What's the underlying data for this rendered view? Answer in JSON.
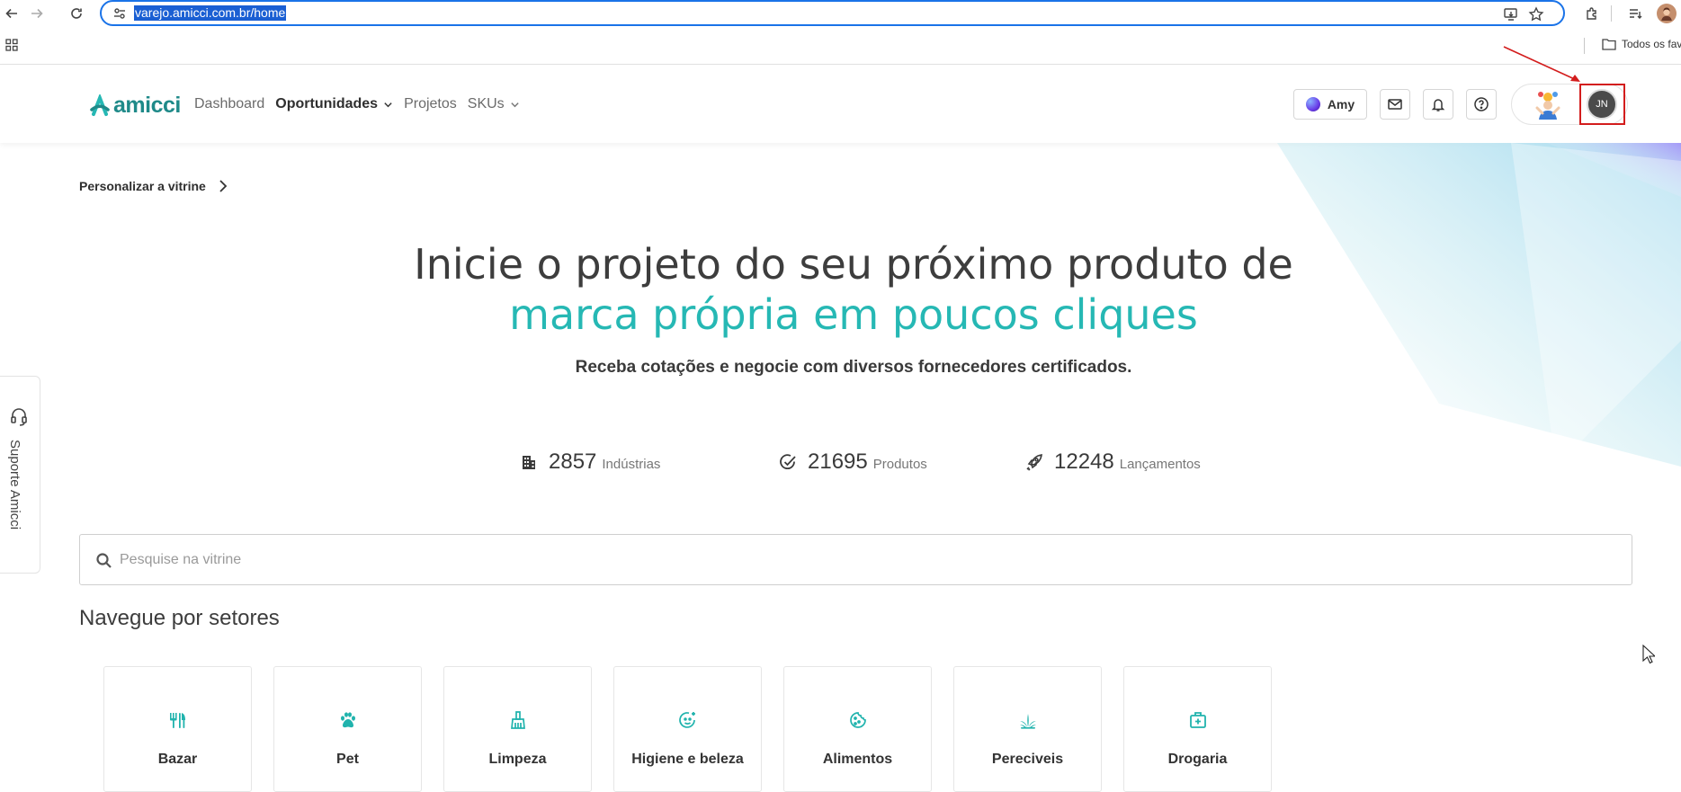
{
  "browser": {
    "url": "varejo.amicci.com.br/home",
    "bookmark_folder": "Todos os fav"
  },
  "header": {
    "logo_text": "amicci",
    "nav": [
      {
        "label": "Dashboard"
      },
      {
        "label": "Oportunidades"
      },
      {
        "label": "Projetos"
      },
      {
        "label": "SKUs"
      }
    ],
    "amy_label": "Amy",
    "avatar_initials": "JN"
  },
  "hero": {
    "personalize_label": "Personalizar a vitrine",
    "title_line1": "Inicie o projeto do seu próximo produto de",
    "title_line2": "marca própria em poucos cliques",
    "subtitle": "Receba cotações e negocie com diversos fornecedores certificados."
  },
  "stats": [
    {
      "value": "2857",
      "label": "Indústrias",
      "icon": "building-icon"
    },
    {
      "value": "21695",
      "label": "Produtos",
      "icon": "check-circle-icon"
    },
    {
      "value": "12248",
      "label": "Lançamentos",
      "icon": "rocket-icon"
    }
  ],
  "support": {
    "label": "Suporte Amicci"
  },
  "search": {
    "placeholder": "Pesquise na vitrine",
    "value": ""
  },
  "sectors": {
    "title": "Navegue por setores",
    "items": [
      {
        "label": "Bazar",
        "icon": "cutlery-icon"
      },
      {
        "label": "Pet",
        "icon": "paw-icon"
      },
      {
        "label": "Limpeza",
        "icon": "broom-icon"
      },
      {
        "label": "Higiene e beleza",
        "icon": "face-sparkle-icon"
      },
      {
        "label": "Alimentos",
        "icon": "cookie-icon"
      },
      {
        "label": "Pereciveis",
        "icon": "plant-icon"
      },
      {
        "label": "Drogaria",
        "icon": "first-aid-icon"
      }
    ]
  },
  "colors": {
    "brand_teal": "#26b8b4",
    "logo_teal": "#1f8a89",
    "highlight_red": "#d31d1d",
    "url_selection": "#1a5fd3"
  }
}
